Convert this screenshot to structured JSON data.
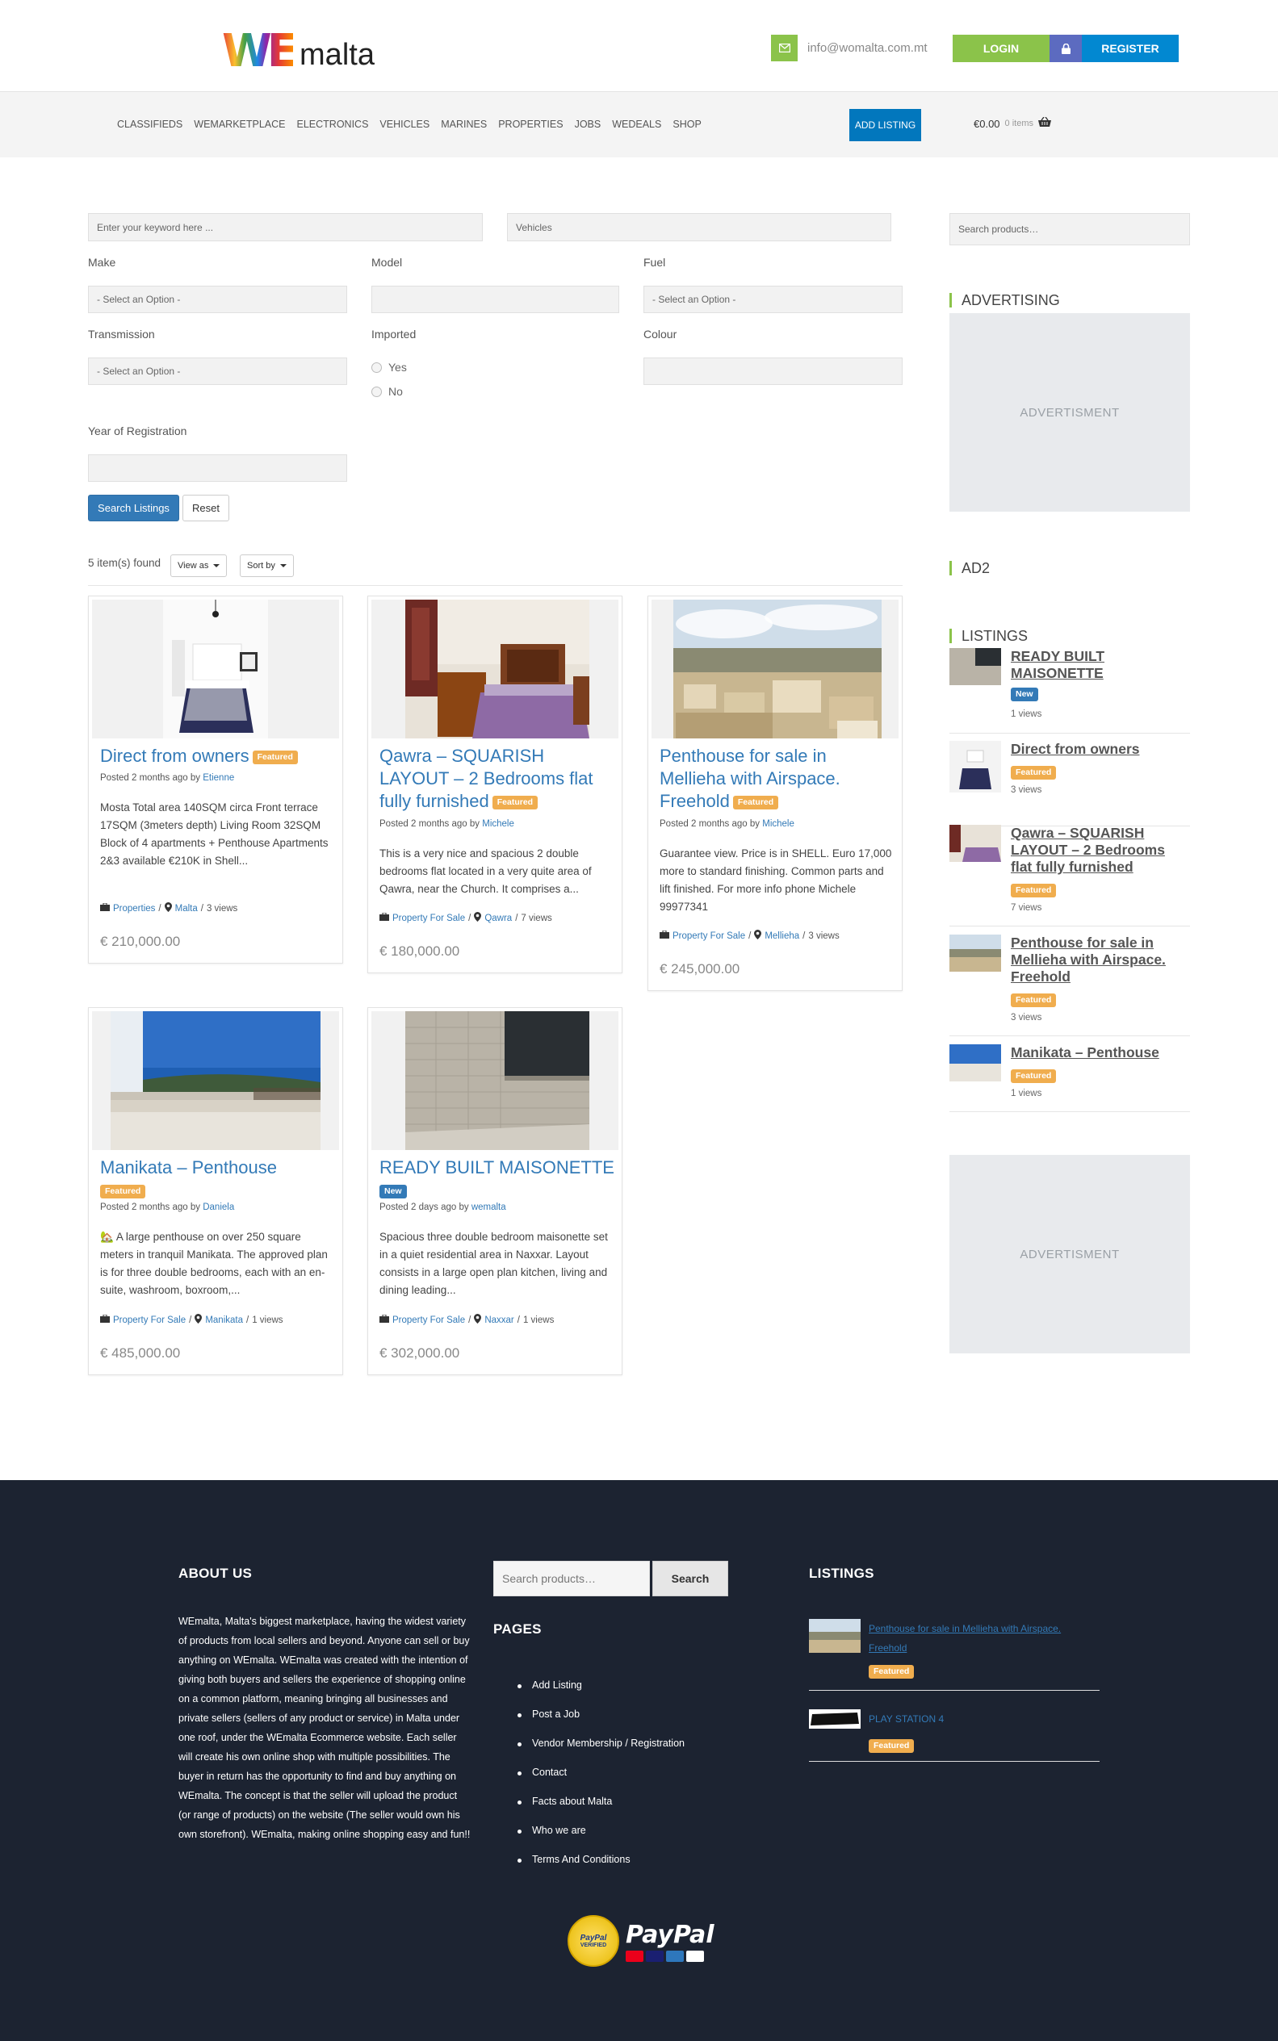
{
  "header": {
    "logo_part1": "WE",
    "logo_part2": "malta",
    "email": "info@womalta.com.mt",
    "login": "LOGIN",
    "register": "REGISTER"
  },
  "nav": {
    "items": [
      "CLASSIFIEDS",
      "WEMARKETPLACE",
      "ELECTRONICS",
      "VEHICLES",
      "MARINES",
      "PROPERTIES",
      "JOBS",
      "WEDEALS",
      "SHOP"
    ],
    "add_listing": "ADD LISTING",
    "cart_total": "€0.00",
    "cart_items": "0 items"
  },
  "filters": {
    "keyword_placeholder": "Enter your keyword here ...",
    "category": "Vehicles",
    "make_label": "Make",
    "make_value": "- Select an Option -",
    "model_label": "Model",
    "fuel_label": "Fuel",
    "fuel_value": "- Select an Option -",
    "transmission_label": "Transmission",
    "transmission_value": "- Select an Option -",
    "imported_label": "Imported",
    "imported_yes": "Yes",
    "imported_no": "No",
    "colour_label": "Colour",
    "year_label": "Year of Registration",
    "search_btn": "Search Listings",
    "reset_btn": "Reset"
  },
  "results": {
    "found": "5 item(s) found",
    "view_as": "View as",
    "sort_by": "Sort by"
  },
  "listings": [
    {
      "title": "Direct from owners",
      "badge": "Featured",
      "posted": "Posted 2 months ago by",
      "author": "Etienne",
      "desc": "Mosta Total area 140SQM circa Front terrace 17SQM (3meters depth) Living Room 32SQM Block of 4 apartments + Penthouse Apartments 2&3 available €210K in Shell...",
      "category": "Properties",
      "location": "Malta",
      "views": "3 views",
      "price": "€ 210,000.00"
    },
    {
      "title": "Qawra – SQUARISH LAYOUT – 2 Bedrooms flat fully furnished",
      "badge": "Featured",
      "posted": "Posted 2 months ago by",
      "author": "Michele",
      "desc": "This is a very nice and spacious 2 double bedrooms flat located in a very quite area of Qawra, near the Church. It comprises a...",
      "category": "Property For Sale",
      "location": "Qawra",
      "views": "7 views",
      "price": "€ 180,000.00"
    },
    {
      "title": "Penthouse for sale in Mellieha with Airspace. Freehold",
      "badge": "Featured",
      "posted": "Posted 2 months ago by",
      "author": "Michele",
      "desc": "Guarantee view. Price is in SHELL. Euro 17,000 more to standard finishing. Common parts and lift finished. For more info phone Michele 99977341",
      "category": "Property For Sale",
      "location": "Mellieha",
      "views": "3 views",
      "price": "€ 245,000.00"
    },
    {
      "title": "Manikata – Penthouse",
      "badge": "Featured",
      "posted": "Posted 2 months ago by",
      "author": "Daniela",
      "desc": "🏡 A large penthouse on over 250 square meters in tranquil Manikata. The approved plan is for three double bedrooms, each with an en-suite, washroom, boxroom,...",
      "category": "Property For Sale",
      "location": "Manikata",
      "views": "1 views",
      "price": "€ 485,000.00"
    },
    {
      "title": "READY BUILT MAISONETTE",
      "badge": "New",
      "posted": "Posted 2 days ago by",
      "author": "wemalta",
      "desc": "Spacious three double bedroom maisonette set in a quiet residential area in Naxxar. Layout consists in a large open plan kitchen, living and dining leading...",
      "category": "Property For Sale",
      "location": "Naxxar",
      "views": "1 views",
      "price": "€ 302,000.00"
    }
  ],
  "sidebar": {
    "search_placeholder": "Search products…",
    "advertising": "ADVERTISING",
    "advertisment": "ADVERTISMENT",
    "ad2": "AD2",
    "listings_title": "LISTINGS",
    "items": [
      {
        "title": "READY BUILT MAISONETTE",
        "badge": "New",
        "views": "1 views"
      },
      {
        "title": "Direct from owners",
        "badge": "Featured",
        "views": "3 views"
      },
      {
        "title": "Qawra – SQUARISH LAYOUT – 2 Bedrooms flat fully furnished",
        "badge": "Featured",
        "views": "7 views"
      },
      {
        "title": "Penthouse for sale in Mellieha with Airspace. Freehold",
        "badge": "Featured",
        "views": "3 views"
      },
      {
        "title": "Manikata – Penthouse",
        "badge": "Featured",
        "views": "1 views"
      }
    ],
    "advertisment2": "ADVERTISMENT"
  },
  "footer": {
    "about_title": "ABOUT US",
    "about_text": "WEmalta, Malta's biggest marketplace, having the widest variety of products from local sellers and beyond. Anyone can sell or buy anything on WEmalta. WEmalta was created with the intention of giving both buyers and sellers the experience of shopping online on a common platform, meaning bringing all businesses and private sellers (sellers of any product or service) in Malta under one roof, under the WEmalta Ecommerce website. Each seller will create his own online shop with multiple possibilities. The buyer in return has the opportunity to find and buy anything on WEmalta. The concept is that the seller will upload the product (or range of products) on the website (The seller would own his own storefront). WEmalta, making online shopping easy and fun!!",
    "search_placeholder": "Search products…",
    "search_btn": "Search",
    "pages_title": "PAGES",
    "pages": [
      "Add Listing",
      "Post a Job",
      "Vendor Membership / Registration",
      "Contact",
      "Facts about Malta",
      "Who we are",
      "Terms And Conditions"
    ],
    "listings_title": "LISTINGS",
    "listings": [
      {
        "title": "Penthouse for sale in Mellieha with Airspace. Freehold",
        "badge": "Featured"
      },
      {
        "title": "PLAY STATION 4",
        "badge": "Featured"
      }
    ],
    "paypal_seal": "PayPal",
    "paypal_verified": "VERIFIED",
    "paypal_word": "PayPal"
  }
}
